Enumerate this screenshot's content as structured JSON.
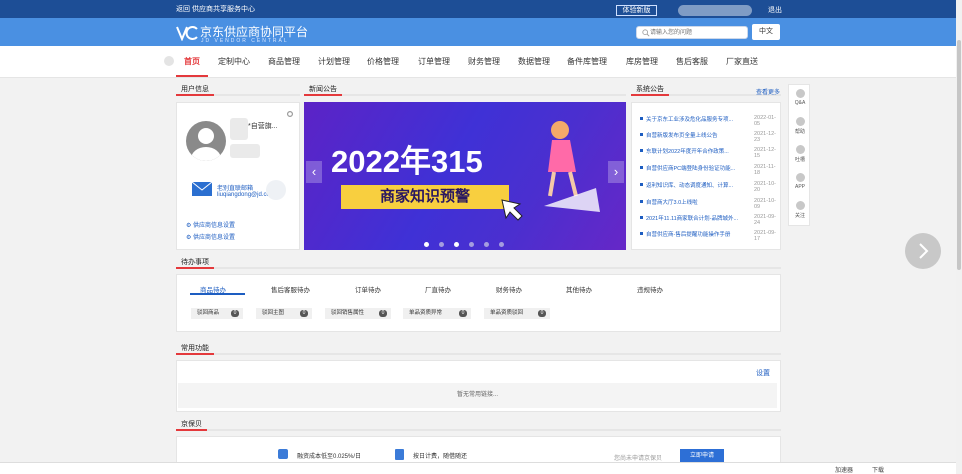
{
  "topbar": {
    "links": "返回 供应商共享服务中心",
    "try_new": "体验新版",
    "logout": "退出"
  },
  "header": {
    "logo_text": "京东供应商协同平台",
    "logo_sub": "JD VENDOR CENTRAL",
    "search_placeholder": "请输入您的问题",
    "lang": "中文"
  },
  "nav": {
    "items": [
      "首页",
      "定制中心",
      "商品管理",
      "计划管理",
      "价格管理",
      "订单管理",
      "财务管理",
      "数据管理",
      "备件库管理",
      "库房管理",
      "售后客服",
      "厂家直送"
    ]
  },
  "user_panel": {
    "title": "用户信息",
    "name": "*自营旗...",
    "mail_label": "老别直联邮箱",
    "mail": "liuqiangdong@jd.com",
    "link1": "供应商信息设置",
    "link2": "供应商信息设置"
  },
  "news": {
    "title": "新闻公告",
    "banner_title": "2022年315",
    "banner_sub": "商家知识预警"
  },
  "system": {
    "title": "系统公告",
    "more": "查看更多",
    "rows": [
      {
        "t": "关于京东工业涉及危化品服务专项...",
        "d": "2022-01-05"
      },
      {
        "t": "自营新版发布页全量上线公告",
        "d": "2021-12-23"
      },
      {
        "t": "东联计划2022年度开年合作政策...",
        "d": "2021-12-15"
      },
      {
        "t": "自营供应商PC端登陆身份验证功能...",
        "d": "2021-11-18"
      },
      {
        "t": "返利知识库、动态调度通知、计算...",
        "d": "2021-10-20"
      },
      {
        "t": "自营商大厅3.0上线啦",
        "d": "2021-10-09"
      },
      {
        "t": "2021年11.11商家联合计划-品牌城外...",
        "d": "2021-09-24"
      },
      {
        "t": "自营供应商-售后提醒功能操作手册",
        "d": "2021-09-17"
      }
    ]
  },
  "sidebar": [
    "Q&A",
    "帮助",
    "吐槽",
    "APP",
    "关注"
  ],
  "todo": {
    "title": "待办事项",
    "tabs": [
      "商品待办",
      "售后客服待办",
      "订单待办",
      "厂直待办",
      "财务待办",
      "其他待办",
      "违规待办"
    ],
    "chips": [
      {
        "label": "驳回商品",
        "count": "0"
      },
      {
        "label": "驳回主图",
        "count": "0"
      },
      {
        "label": "驳回销售属性",
        "count": "0"
      },
      {
        "label": "单品资质异常",
        "count": "0"
      },
      {
        "label": "单品资质驳回",
        "count": "0"
      }
    ]
  },
  "common": {
    "title": "常用功能",
    "settings": "设置",
    "empty": "暂无常用链接..."
  },
  "jbb": {
    "title": "京保贝",
    "f1": "融资成本低至0.025%/日",
    "f2": "按日计费，随借随还",
    "apply_hint": "您尚未申请京保贝",
    "apply": "立即申请"
  },
  "bottom": {
    "accelerate": "加速器",
    "download": "下载"
  }
}
